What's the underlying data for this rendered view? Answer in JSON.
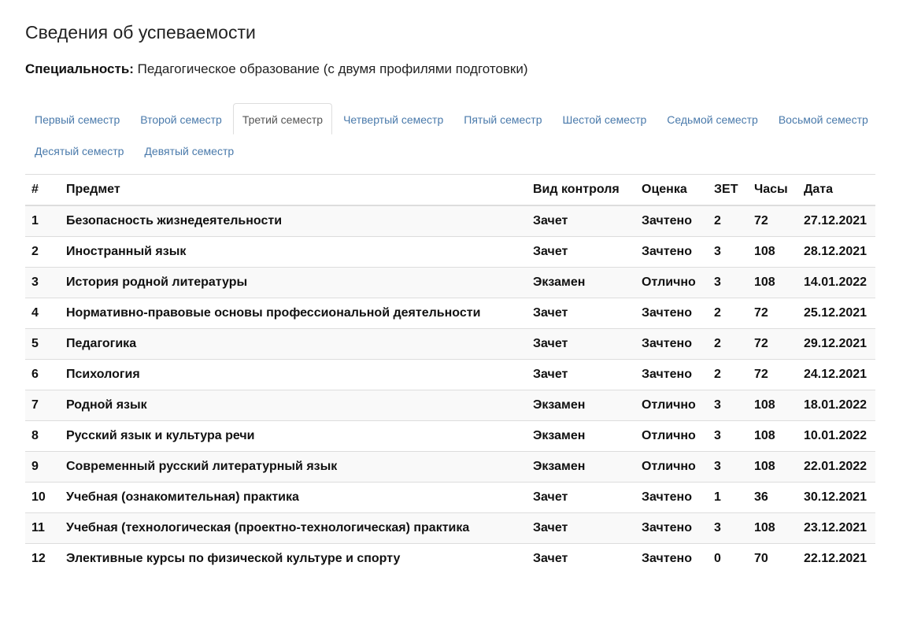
{
  "page": {
    "title": "Сведения об успеваемости",
    "specialty_label": "Специальность:",
    "specialty_value": "Педагогическое образование (с двумя профилями подготовки)"
  },
  "tabs": {
    "row1": [
      {
        "label": "Первый семестр",
        "active": false
      },
      {
        "label": "Второй семестр",
        "active": false
      },
      {
        "label": "Третий семестр",
        "active": true
      },
      {
        "label": "Четвертый семестр",
        "active": false
      },
      {
        "label": "Пятый семестр",
        "active": false
      },
      {
        "label": "Шестой семестр",
        "active": false
      },
      {
        "label": "Седьмой семестр",
        "active": false
      },
      {
        "label": "Восьмой семестр",
        "active": false
      }
    ],
    "row2": [
      {
        "label": "Десятый семестр",
        "active": false
      },
      {
        "label": "Девятый семестр",
        "active": false
      }
    ]
  },
  "table": {
    "headers": {
      "num": "#",
      "subject": "Предмет",
      "control": "Вид контроля",
      "grade": "Оценка",
      "zet": "ЗЕТ",
      "hours": "Часы",
      "date": "Дата"
    },
    "rows": [
      {
        "num": "1",
        "subject": "Безопасность жизнедеятельности",
        "control": "Зачет",
        "grade": "Зачтено",
        "zet": "2",
        "hours": "72",
        "date": "27.12.2021"
      },
      {
        "num": "2",
        "subject": "Иностранный язык",
        "control": "Зачет",
        "grade": "Зачтено",
        "zet": "3",
        "hours": "108",
        "date": "28.12.2021"
      },
      {
        "num": "3",
        "subject": "История родной литературы",
        "control": "Экзамен",
        "grade": "Отлично",
        "zet": "3",
        "hours": "108",
        "date": "14.01.2022"
      },
      {
        "num": "4",
        "subject": "Нормативно-правовые основы профессиональной деятельности",
        "control": "Зачет",
        "grade": "Зачтено",
        "zet": "2",
        "hours": "72",
        "date": "25.12.2021"
      },
      {
        "num": "5",
        "subject": "Педагогика",
        "control": "Зачет",
        "grade": "Зачтено",
        "zet": "2",
        "hours": "72",
        "date": "29.12.2021"
      },
      {
        "num": "6",
        "subject": "Психология",
        "control": "Зачет",
        "grade": "Зачтено",
        "zet": "2",
        "hours": "72",
        "date": "24.12.2021"
      },
      {
        "num": "7",
        "subject": "Родной язык",
        "control": "Экзамен",
        "grade": "Отлично",
        "zet": "3",
        "hours": "108",
        "date": "18.01.2022"
      },
      {
        "num": "8",
        "subject": "Русский язык и культура речи",
        "control": "Экзамен",
        "grade": "Отлично",
        "zet": "3",
        "hours": "108",
        "date": "10.01.2022"
      },
      {
        "num": "9",
        "subject": "Современный русский литературный язык",
        "control": "Экзамен",
        "grade": "Отлично",
        "zet": "3",
        "hours": "108",
        "date": "22.01.2022"
      },
      {
        "num": "10",
        "subject": "Учебная (ознакомительная) практика",
        "control": "Зачет",
        "grade": "Зачтено",
        "zet": "1",
        "hours": "36",
        "date": "30.12.2021"
      },
      {
        "num": "11",
        "subject": "Учебная (технологическая (проектно-технологическая) практика",
        "control": "Зачет",
        "grade": "Зачтено",
        "zet": "3",
        "hours": "108",
        "date": "23.12.2021"
      },
      {
        "num": "12",
        "subject": "Элективные курсы по физической культуре и спорту",
        "control": "Зачет",
        "grade": "Зачтено",
        "zet": "0",
        "hours": "70",
        "date": "22.12.2021"
      }
    ]
  },
  "colors": {
    "link": "#4a7aab",
    "active_tab_text": "#555555",
    "border": "#dddddd",
    "stripe": "#f9f9f9"
  }
}
